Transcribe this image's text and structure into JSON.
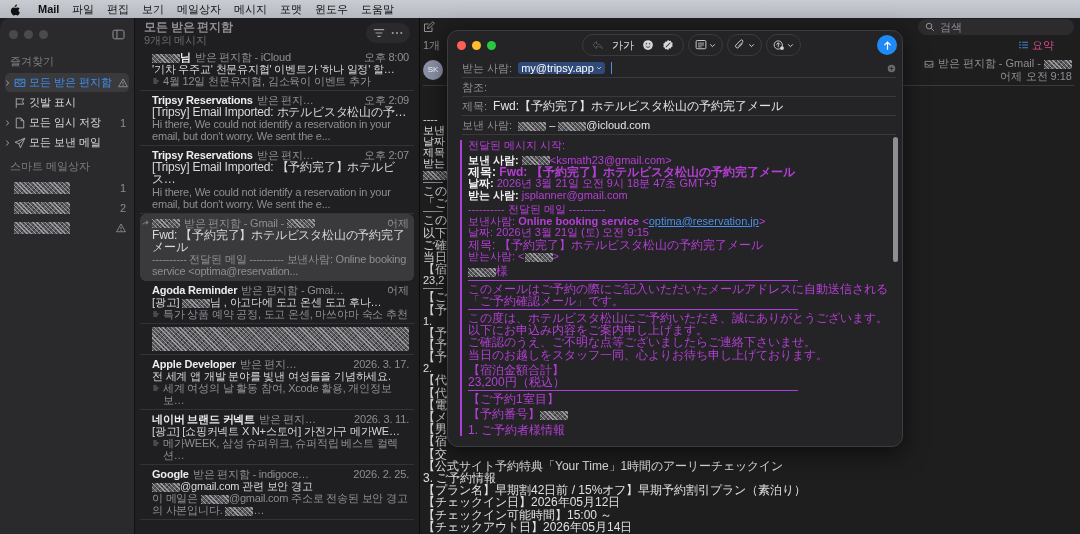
{
  "menubar": {
    "app": "Mail",
    "items": [
      "파일",
      "편집",
      "보기",
      "메일상자",
      "메시지",
      "포맷",
      "윈도우",
      "도움말"
    ]
  },
  "sidebar": {
    "sections": [
      {
        "title": "즐겨찾기",
        "items": [
          {
            "kind": "inbox",
            "label": "모든 받은 편지함",
            "selected": true,
            "expandable": true,
            "warning": true
          },
          {
            "kind": "flag",
            "label": "깃발 표시",
            "selected": false,
            "expandable": false,
            "warning": false
          },
          {
            "kind": "drafts",
            "label": "모든 임시 저장",
            "selected": false,
            "expandable": true,
            "warning": false,
            "count": "1"
          },
          {
            "kind": "sent",
            "label": "모든 보낸 메일",
            "selected": false,
            "expandable": true,
            "warning": false
          }
        ]
      },
      {
        "title": "스마트 메일상자",
        "items": [
          {
            "kind": "redacted",
            "selected": false,
            "expandable": false,
            "warning": false,
            "count": "1"
          },
          {
            "kind": "redacted",
            "selected": false,
            "expandable": false,
            "warning": false,
            "count": "2"
          },
          {
            "kind": "redacted",
            "selected": false,
            "expandable": false,
            "warning": true
          }
        ]
      }
    ]
  },
  "message_list": {
    "title": "모든 받은 편지함",
    "subtitle": "9개의 메시지",
    "messages": [
      {
        "kind": "mail",
        "selected": false,
        "forwarded": false,
        "summarized": true,
        "sender": [
          {
            "kind": "redacted"
          },
          "님"
        ],
        "mailbox": "받은 편지함 - iCloud",
        "time": "오후 8:00",
        "subject": "'기차 우주교' 천문유지협' 이벤트가 '하나 일정' 할…",
        "preview": "4월 12일 천문유지협, 김소육이 이벤트 추가"
      },
      {
        "kind": "mail",
        "selected": false,
        "forwarded": false,
        "summarized": false,
        "sender": "Tripsy Reservations",
        "mailbox": "받은 편지…",
        "time": "오후 2:09",
        "subject": "[Tripsy] Email Imported: ホテルビスタ松山の予…",
        "preview": "Hi there, We could not identify a reservation in your email, but don't worry. We sent the e..."
      },
      {
        "kind": "mail",
        "selected": false,
        "forwarded": false,
        "summarized": false,
        "sender": "Tripsy Reservations",
        "mailbox": "받은 편지…",
        "time": "오후 2:07",
        "subject": "[Tripsy] Email Imported: 【予約完了】ホテルビス…",
        "preview": "Hi there, We could not identify a reservation in your email, but don't worry. We sent the e..."
      },
      {
        "kind": "mail",
        "selected": true,
        "forwarded": true,
        "summarized": false,
        "sender": [
          {
            "kind": "redacted"
          }
        ],
        "mailbox": [
          "받은 편지함 - Gmail - ",
          {
            "kind": "redacted"
          }
        ],
        "time": "어제",
        "subject": "Fwd: 【予約完了】ホテルビスタ松山の予約完了メール",
        "preview": "---------- 전달된 메일 ---------- 보낸사람: Online booking service <optima@reservation..."
      },
      {
        "kind": "mail",
        "selected": false,
        "forwarded": false,
        "summarized": true,
        "sender": "Agoda Reminder",
        "mailbox": "받은 편지함 - Gmai…",
        "time": "어제",
        "subject": [
          "[광고] ",
          {
            "kind": "redacted"
          },
          "님 , 아고다에 도고 온센 도고 후나…"
        ],
        "preview": "특가 상품 예약 공정, 도고 온센, 마쓰야마 숙소 추천"
      },
      {
        "kind": "redacted",
        "selected": false
      },
      {
        "kind": "mail",
        "selected": false,
        "forwarded": false,
        "summarized": true,
        "sender": "Apple Developer",
        "mailbox": "받은 편지…",
        "time": "2026. 3. 17.",
        "subject": "전 세계 앱 개발 분야를 빛낸 여성들을 기념하세요.",
        "preview": "세계 여성의 날 활동 참여, Xcode 활용, 개인정보 보…"
      },
      {
        "kind": "mail",
        "selected": false,
        "forwarded": false,
        "summarized": true,
        "sender": "네이버 브랜드 커넥트",
        "mailbox": "받은 편지…",
        "time": "2026. 3. 11.",
        "subject": "[광고] [쇼핑커넥트 X N+스토어] 가전가구 메가WE…",
        "preview": "메가WEEK, 삼성 슈퍼위크, 슈퍼적립 베스트 컬렉션…"
      },
      {
        "kind": "mail",
        "selected": false,
        "forwarded": false,
        "summarized": false,
        "sender": "Google",
        "mailbox": "받은 편지함 - indigoce…",
        "time": "2026. 2. 25.",
        "subject": [
          {
            "kind": "redacted"
          },
          "@gmail.com 관련 보안 경고"
        ],
        "preview": [
          "이 메일은 ",
          {
            "kind": "redacted"
          },
          "@gmail.com 주소로 전송된 보안 경고의 사본입니다. ",
          {
            "kind": "redacted"
          },
          "…"
        ]
      }
    ]
  },
  "reading_pane": {
    "count_label": "1개",
    "summary_button": "요약",
    "search": {
      "placeholder": "검색"
    },
    "message": {
      "avatar": "SK",
      "mailbox": [
        "받은 편지함 - Gmail - ",
        {
          "kind": "redacted"
        }
      ],
      "date": "어제 오전 9:18",
      "lines": [
        {
          "kind": "text",
          "parts": "----"
        },
        {
          "kind": "text",
          "parts": "보낸"
        },
        {
          "kind": "text",
          "parts": "날짜"
        },
        {
          "kind": "text",
          "parts": "제목"
        },
        {
          "kind": "text",
          "parts": "받는"
        },
        {
          "kind": "text",
          "parts": [
            {
              "kind": "redacted"
            }
          ]
        },
        {
          "kind": "rule"
        },
        {
          "kind": "text",
          "parts": "この"
        },
        {
          "kind": "text",
          "parts": "「ご"
        },
        {
          "kind": "rule"
        },
        {
          "kind": "text",
          "parts": "この"
        },
        {
          "kind": "text",
          "parts": "以下"
        },
        {
          "kind": "text",
          "parts": "ご確"
        },
        {
          "kind": "text",
          "parts": "当日"
        },
        {
          "kind": "text",
          "parts": "【宿"
        },
        {
          "kind": "text",
          "parts": "23,2"
        },
        {
          "kind": "rule"
        },
        {
          "kind": "text",
          "parts": "【ご"
        },
        {
          "kind": "text",
          "parts": "【予"
        },
        {
          "kind": "text",
          "parts": "1."
        },
        {
          "kind": "text",
          "parts": "【予"
        },
        {
          "kind": "text",
          "parts": "【予"
        },
        {
          "kind": "text",
          "parts": "【予"
        },
        {
          "kind": "text",
          "parts": "2."
        },
        {
          "kind": "text",
          "parts": "【代"
        },
        {
          "kind": "text",
          "parts": "【代"
        },
        {
          "kind": "text",
          "parts": "【電"
        },
        {
          "kind": "text",
          "parts": "【メ"
        },
        {
          "kind": "text",
          "parts": "【男"
        },
        {
          "kind": "text",
          "parts": "【宿"
        },
        {
          "kind": "text",
          "parts": "【交"
        },
        {
          "kind": "text",
          "parts": "【公式サイト予約特典「Your Time」1時間のアーリーチェックイン"
        },
        {
          "kind": "text",
          "parts": "3. ご予約情報"
        },
        {
          "kind": "text",
          "parts": "【プラン名】早期割42日前 / 15%オフ】早期予約割引プラン（素泊り）"
        },
        {
          "kind": "text",
          "parts": "【チェックイン日】2026年05月12日"
        },
        {
          "kind": "text",
          "parts": "【チェックイン可能時間】15:00 ～"
        },
        {
          "kind": "text",
          "parts": "【チェックアウト日】2026年05月14日"
        }
      ]
    }
  },
  "compose": {
    "reply_disabled": true,
    "format_label": "가가",
    "fields": [
      {
        "kind": "to",
        "label": "받는 사람:",
        "tokens": [
          "my@tripsy.app"
        ]
      },
      {
        "kind": "cc",
        "label": "참조:"
      },
      {
        "kind": "subject",
        "label": "제목:",
        "value": "Fwd:【予約完了】ホテルビスタ松山の予約完了メール"
      },
      {
        "kind": "from",
        "label": "보낸 사람:",
        "value": [
          {
            "kind": "redacted"
          },
          " – ",
          {
            "kind": "redacted"
          },
          "@icloud.com"
        ]
      }
    ],
    "body": [
      {
        "kind": "text",
        "parts": "전달된 메시지 시작:"
      },
      {
        "kind": "blank"
      },
      {
        "kind": "text",
        "parts": [
          {
            "kind": "label",
            "text": "보낸 사람: "
          },
          {
            "kind": "redacted"
          },
          "<ksmath23@gmail.com>"
        ]
      },
      {
        "kind": "text",
        "parts": [
          {
            "kind": "label",
            "text": "제목: "
          },
          {
            "kind": "strong",
            "text": "Fwd: 【予約完了】ホテルビスタ松山の予約完了メール"
          }
        ]
      },
      {
        "kind": "text",
        "parts": [
          {
            "kind": "label",
            "text": "날짜: "
          },
          "2026년 3월 21일 오전 9시 18분 47초 GMT+9"
        ]
      },
      {
        "kind": "text",
        "parts": [
          {
            "kind": "label",
            "text": "받는 사람: "
          },
          "jsplanner@gmail.com"
        ]
      },
      {
        "kind": "blank"
      },
      {
        "kind": "text",
        "parts": "---------- 전달된 메일 ----------"
      },
      {
        "kind": "text",
        "parts": [
          "보낸사람: ",
          {
            "kind": "strong",
            "text": "Online booking service"
          },
          " <",
          {
            "kind": "link",
            "text": "optima@reservation.jp"
          },
          ">"
        ]
      },
      {
        "kind": "text",
        "parts": "날짜: 2026년 3월 21일 (토) 오전 9:15"
      },
      {
        "kind": "text",
        "parts": "제목: 【予約完了】ホテルビスタ松山の予約完了メール"
      },
      {
        "kind": "text",
        "parts": [
          "받는사람: <",
          {
            "kind": "redacted"
          },
          ">"
        ]
      },
      {
        "kind": "blank"
      },
      {
        "kind": "text",
        "parts": [
          {
            "kind": "redacted"
          },
          "様"
        ]
      },
      {
        "kind": "rule"
      },
      {
        "kind": "text",
        "parts": "このメールはご予約の際にご記入いただいたメールアドレスに自動送信される"
      },
      {
        "kind": "text",
        "parts": "「ご予約確認メール」です。"
      },
      {
        "kind": "rule"
      },
      {
        "kind": "text",
        "parts": "この度は、ホテルビスタ松山にご予約いただき、誠にありがとうございます。"
      },
      {
        "kind": "text",
        "parts": "以下にお申込み内容をご案内申し上げます。"
      },
      {
        "kind": "text",
        "parts": "ご確認のうえ、ご不明な点等ございましたらご連絡下さいませ。"
      },
      {
        "kind": "text",
        "parts": "当日のお越しをスタッフ一同、心よりお待ち申し上げております。"
      },
      {
        "kind": "blank"
      },
      {
        "kind": "text",
        "parts": "【宿泊金額合計】"
      },
      {
        "kind": "text",
        "parts": " 23,200円（税込）"
      },
      {
        "kind": "rule"
      },
      {
        "kind": "text",
        "parts": "【ご予約1室目】"
      },
      {
        "kind": "blank"
      },
      {
        "kind": "text",
        "parts": [
          "【予約番号】",
          {
            "kind": "redacted"
          }
        ]
      },
      {
        "kind": "blank"
      },
      {
        "kind": "text",
        "parts": "1. ご予約者様情報"
      }
    ]
  }
}
